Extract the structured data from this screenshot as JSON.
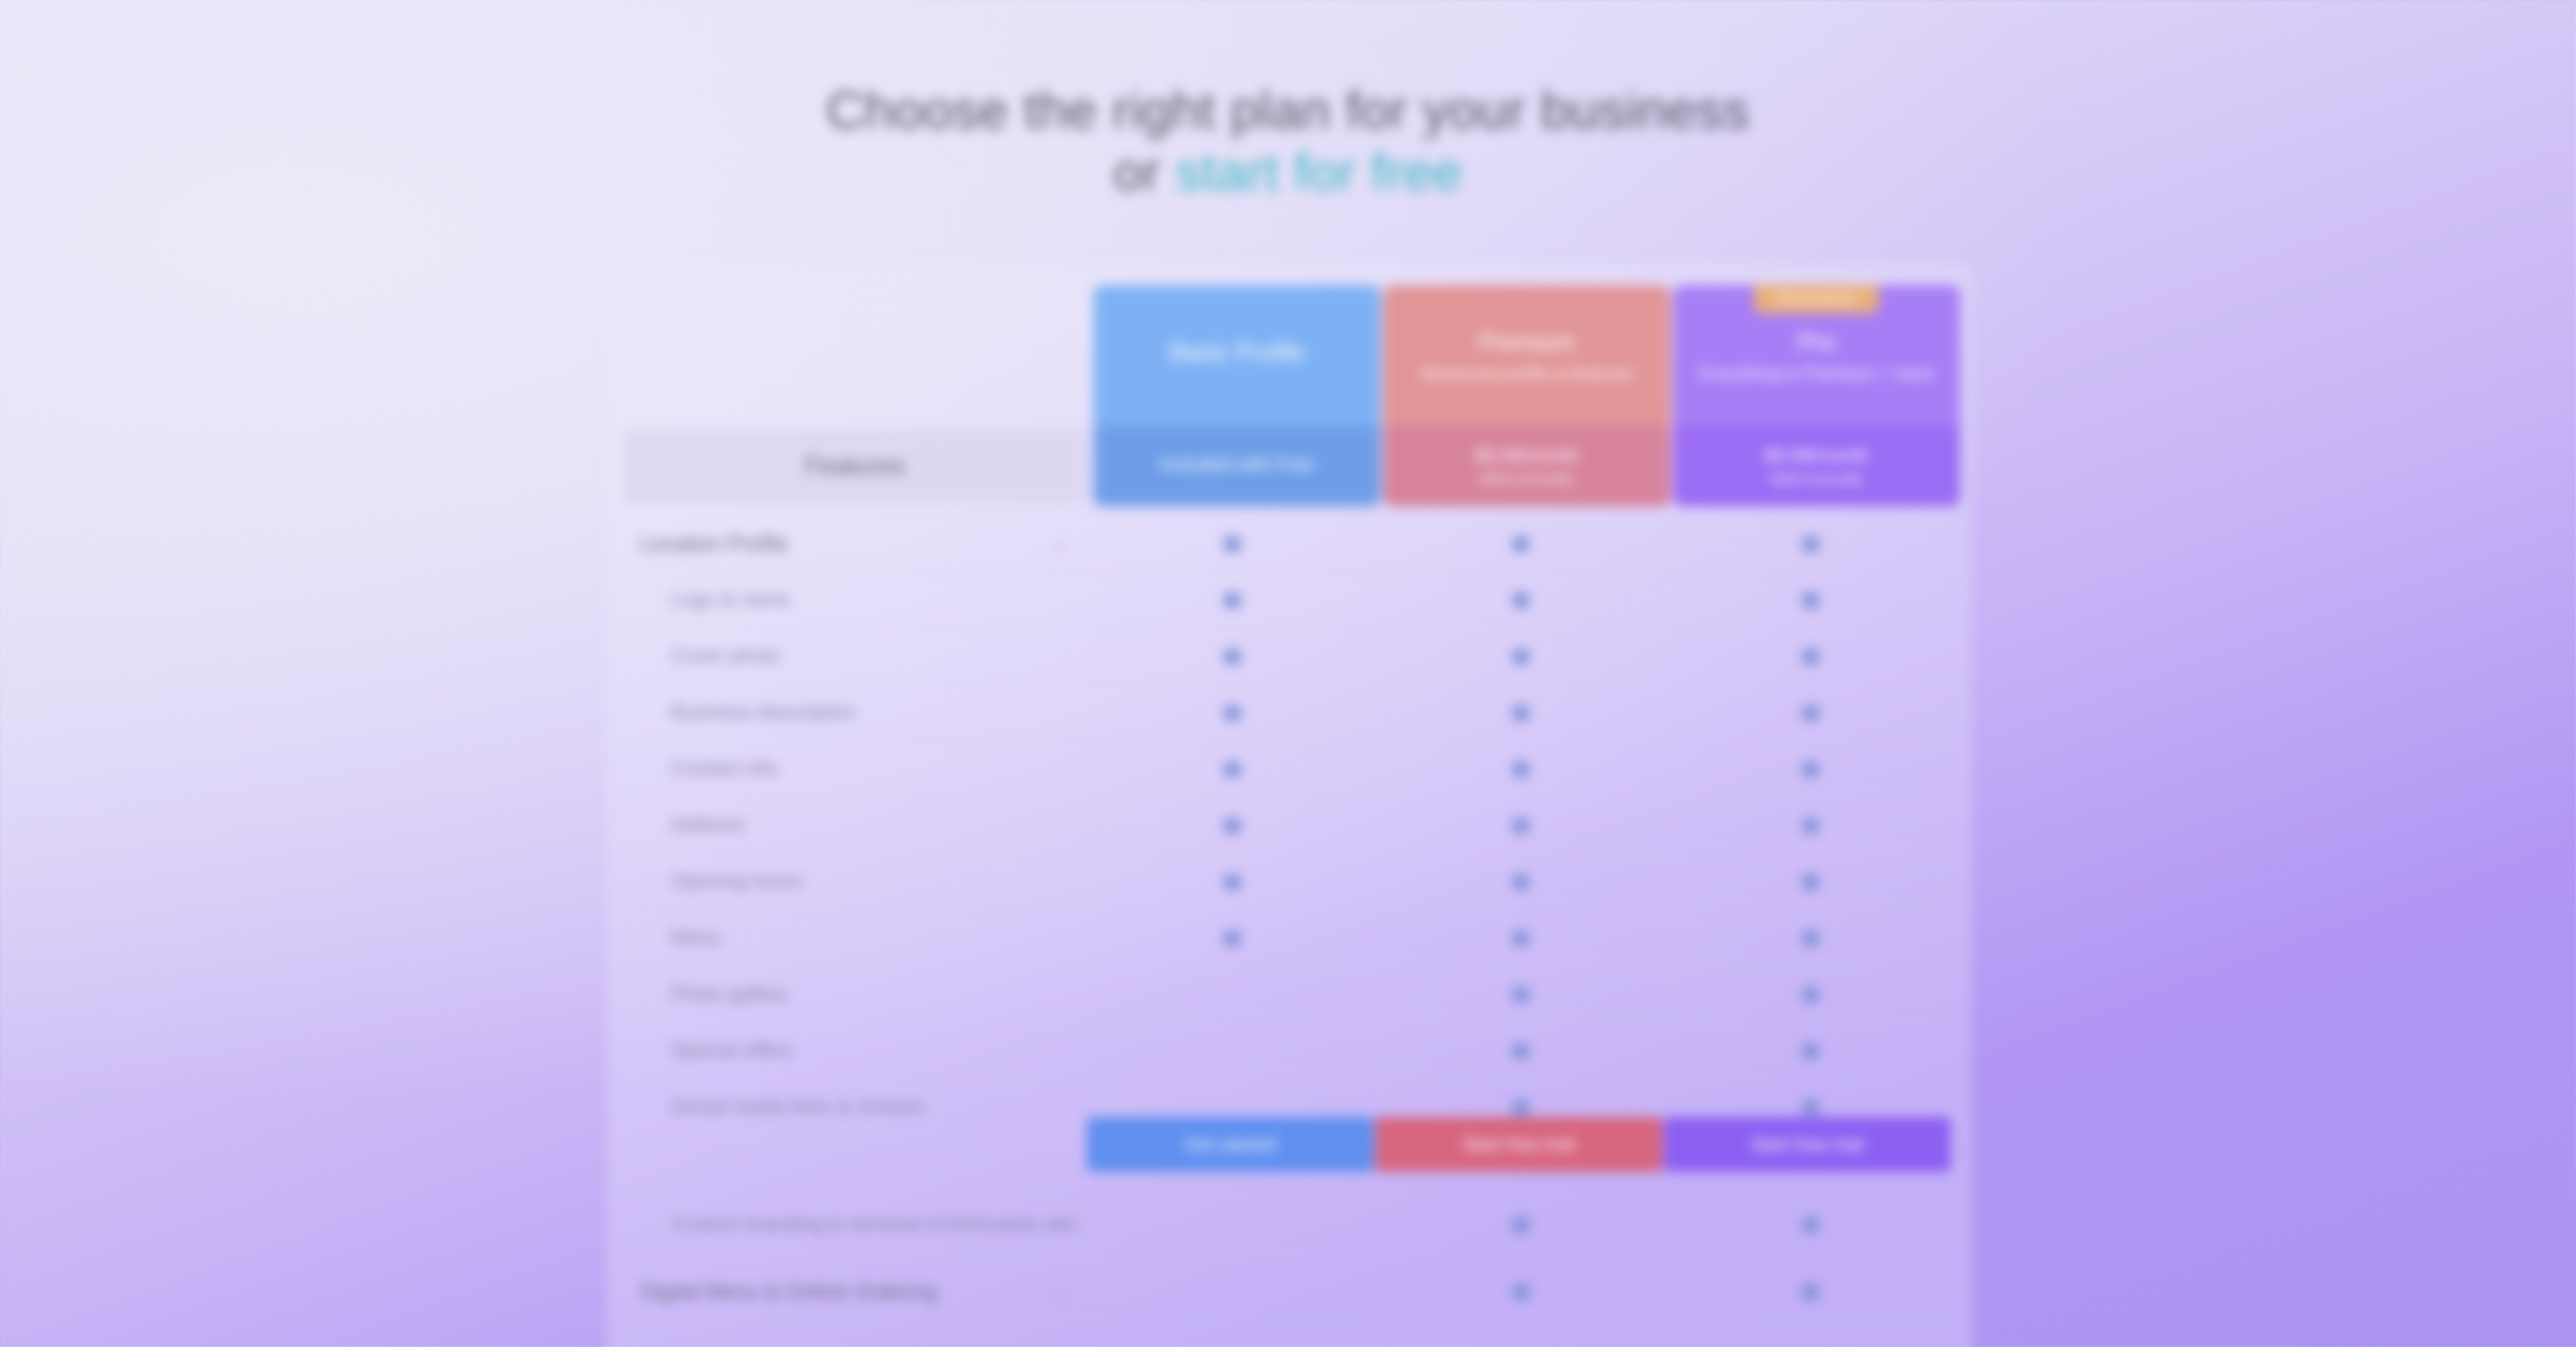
{
  "headline": {
    "line1": "Choose the right plan for your business",
    "line2_prefix": "or",
    "line2_link": "start for free"
  },
  "table": {
    "features_header": "Features",
    "plans": [
      {
        "name": "Basic Profile",
        "subtitle": "",
        "price": "Included with Free",
        "price_sub": "",
        "color": "#7eb1f4"
      },
      {
        "name": "Premium",
        "subtitle": "Advanced profile & features",
        "price": "$5.99/month",
        "price_sub": "billed annually",
        "color": "#e19597"
      },
      {
        "name": "Pro",
        "subtitle": "Everything in Premium + more",
        "price": "$9.99/month",
        "price_sub": "billed annually",
        "color": "#a77ef6"
      }
    ],
    "badge": "Most popular",
    "rows": [
      {
        "label": "Location Profile",
        "section": true,
        "checks": [
          true,
          true,
          true
        ]
      },
      {
        "label": "Logo & name",
        "section": false,
        "checks": [
          true,
          true,
          true
        ]
      },
      {
        "label": "Cover photo",
        "section": false,
        "checks": [
          true,
          true,
          true
        ]
      },
      {
        "label": "Business description",
        "section": false,
        "checks": [
          true,
          true,
          true
        ]
      },
      {
        "label": "Contact info",
        "section": false,
        "checks": [
          true,
          true,
          true
        ]
      },
      {
        "label": "Address",
        "section": false,
        "checks": [
          true,
          true,
          true
        ]
      },
      {
        "label": "Opening hours",
        "section": false,
        "checks": [
          true,
          true,
          true
        ]
      },
      {
        "label": "Menu",
        "section": false,
        "checks": [
          true,
          true,
          true
        ]
      },
      {
        "label": "Photo gallery",
        "section": false,
        "checks": [
          false,
          true,
          true
        ]
      },
      {
        "label": "Special offers",
        "section": false,
        "checks": [
          false,
          true,
          true
        ]
      },
      {
        "label": "Social media links & reviews",
        "section": false,
        "checks": [
          false,
          true,
          true
        ]
      }
    ],
    "cta": [
      "Get started",
      "Start free trial",
      "Start free trial"
    ],
    "after_rows": [
      {
        "label": "Custom branding & removal of third-party ads",
        "section": false,
        "checks": [
          false,
          true,
          true
        ]
      },
      {
        "label": "Digital Menu & Online Ordering",
        "section": true,
        "checks": [
          false,
          true,
          true
        ]
      }
    ]
  }
}
